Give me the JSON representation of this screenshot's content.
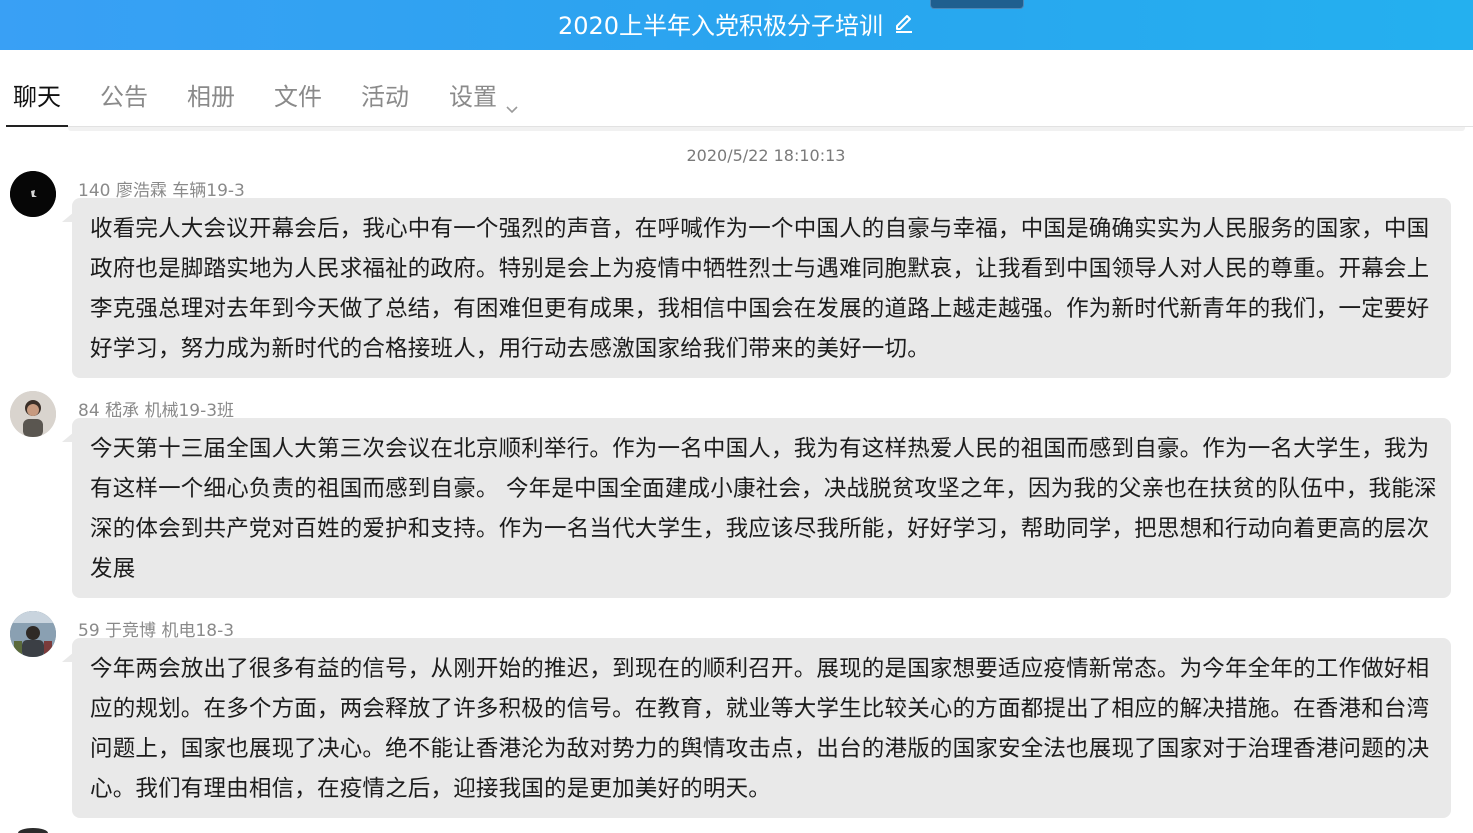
{
  "window": {
    "title": "2020上半年入党积极分子培训"
  },
  "tabs": [
    {
      "label": "聊天",
      "active": true
    },
    {
      "label": "公告",
      "active": false
    },
    {
      "label": "相册",
      "active": false
    },
    {
      "label": "文件",
      "active": false
    },
    {
      "label": "活动",
      "active": false
    },
    {
      "label": "设置",
      "active": false
    }
  ],
  "chat": {
    "timestamp": "2020/5/22 18:10:13",
    "messages": [
      {
        "sender": "140 廖浩霖 车辆19-3",
        "text": "收看完人大会议开幕会后，我心中有一个强烈的声音，在呼喊作为一个中国人的自豪与幸福，中国是确确实实为人民服务的国家，中国政府也是脚踏实地为人民求福祉的政府。特别是会上为疫情中牺牲烈士与遇难同胞默哀，让我看到中国领导人对人民的尊重。开幕会上李克强总理对去年到今天做了总结，有困难但更有成果，我相信中国会在发展的道路上越走越强。作为新时代新青年的我们，一定要好好学习，努力成为新时代的合格接班人，用行动去感激国家给我们带来的美好一切。"
      },
      {
        "sender": "84 嵇承 机械19-3班",
        "text": "今天第十三届全国人大第三次会议在北京顺利举行。作为一名中国人，我为有这样热爱人民的祖国而感到自豪。作为一名大学生，我为有这样一个细心负责的祖国而感到自豪。 今年是中国全面建成小康社会，决战脱贫攻坚之年，因为我的父亲也在扶贫的队伍中，我能深深的体会到共产党对百姓的爱护和支持。作为一名当代大学生，我应该尽我所能，好好学习，帮助同学，把思想和行动向着更高的层次发展"
      },
      {
        "sender": "59 于竞博 机电18-3",
        "text": "今年两会放出了很多有益的信号，从刚开始的推迟，到现在的顺利召开。展现的是国家想要适应疫情新常态。为今年全年的工作做好相应的规划。在多个方面，两会释放了许多积极的信号。在教育，就业等大学生比较关心的方面都提出了相应的解决措施。在香港和台湾问题上，国家也展现了决心。绝不能让香港沦为敌对势力的舆情攻击点，出台的港版的国家安全法也展现了国家对于治理香港问题的决心。我们有理由相信，在疫情之后，迎接我国的是更加美好的明天。"
      }
    ]
  },
  "colors": {
    "titlebar_start": "#39a0f5",
    "titlebar_end": "#24b0ef",
    "bubble_bg": "#e9e9e9",
    "active_tab": "#111111",
    "inactive_tab": "#8a8a8a"
  }
}
